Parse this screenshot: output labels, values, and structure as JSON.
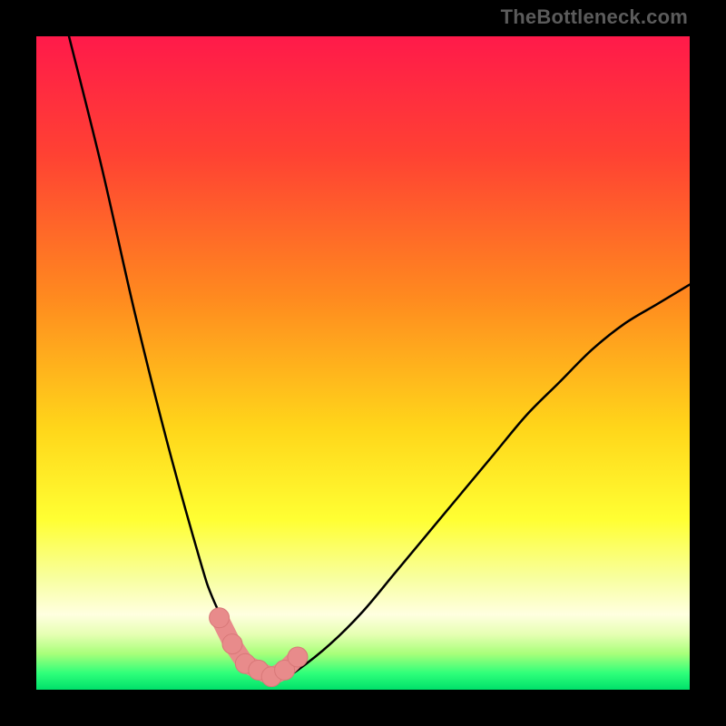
{
  "watermark": "TheBottleneck.com",
  "colors": {
    "frame": "#000000",
    "curve_stroke": "#000000",
    "marker_fill": "#e88b8b",
    "marker_stroke": "#d87878",
    "gradient_stops": [
      {
        "offset": 0.0,
        "hex": "#ff1a4a"
      },
      {
        "offset": 0.18,
        "hex": "#ff4133"
      },
      {
        "offset": 0.4,
        "hex": "#ff8a1f"
      },
      {
        "offset": 0.6,
        "hex": "#ffd61a"
      },
      {
        "offset": 0.74,
        "hex": "#ffff33"
      },
      {
        "offset": 0.83,
        "hex": "#f8ffa0"
      },
      {
        "offset": 0.885,
        "hex": "#ffffe0"
      },
      {
        "offset": 0.915,
        "hex": "#e6ffb3"
      },
      {
        "offset": 0.945,
        "hex": "#a8ff7a"
      },
      {
        "offset": 0.975,
        "hex": "#2eff7a"
      },
      {
        "offset": 1.0,
        "hex": "#00e06a"
      }
    ]
  },
  "chart_data": {
    "type": "line",
    "title": "",
    "xlabel": "",
    "ylabel": "",
    "xlim": [
      0,
      100
    ],
    "ylim": [
      0,
      100
    ],
    "series": [
      {
        "name": "bottleneck-curve",
        "x": [
          5,
          10,
          15,
          20,
          25,
          27,
          30,
          32,
          34,
          36,
          38,
          40,
          45,
          50,
          55,
          60,
          65,
          70,
          75,
          80,
          85,
          90,
          95,
          100
        ],
        "y": [
          100,
          80,
          58,
          38,
          20,
          14,
          8,
          5,
          3,
          2,
          2,
          3,
          7,
          12,
          18,
          24,
          30,
          36,
          42,
          47,
          52,
          56,
          59,
          62
        ]
      }
    ],
    "markers": {
      "name": "highlighted-points",
      "x": [
        28,
        30,
        32,
        34,
        36,
        38,
        40
      ],
      "y": [
        11,
        7,
        4,
        3,
        2,
        3,
        5
      ]
    }
  }
}
